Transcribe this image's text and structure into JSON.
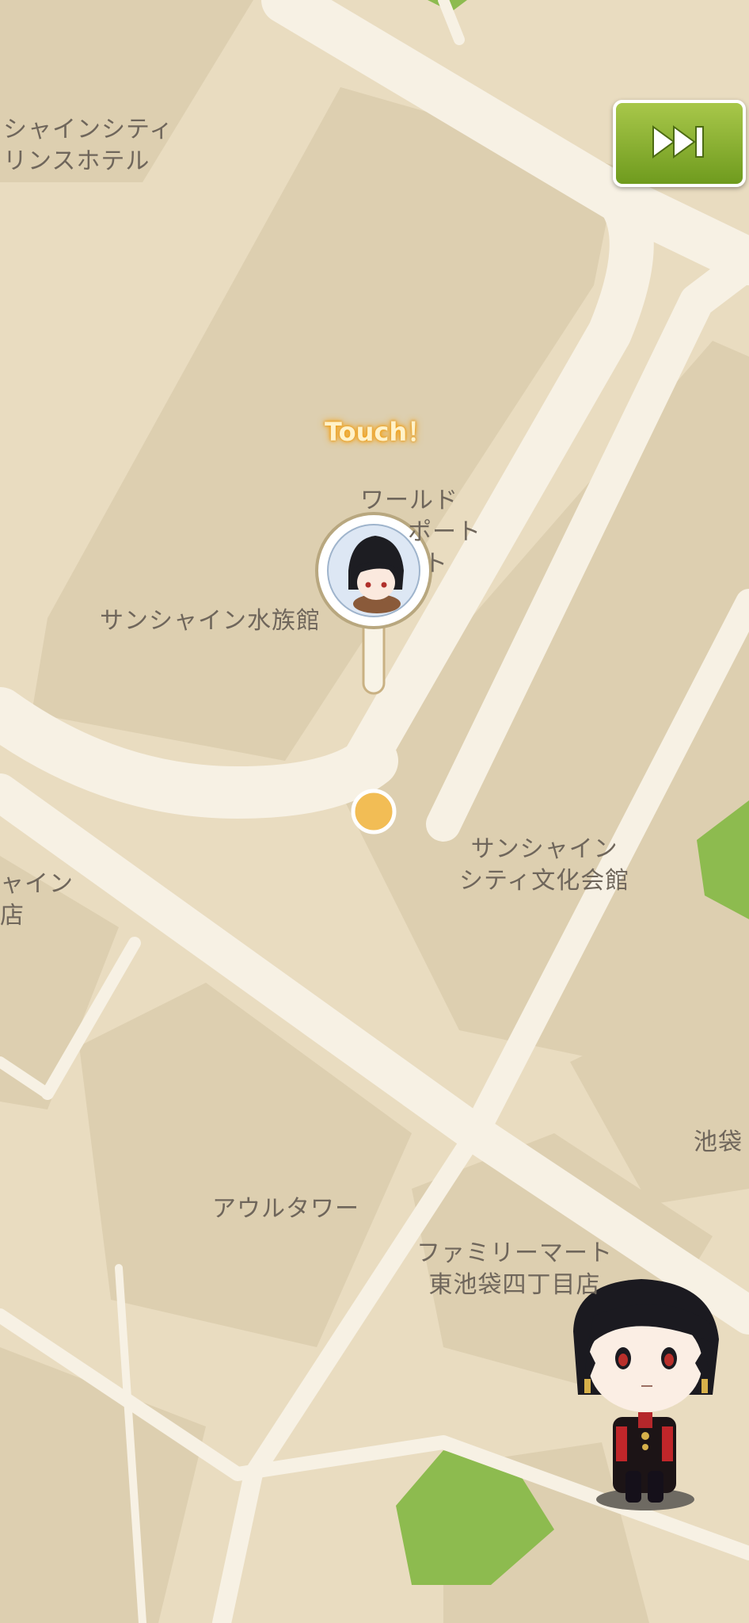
{
  "map": {
    "labels": {
      "prince_hotel_1": "シャインシティ",
      "prince_hotel_2": "リンスホテル",
      "world_1": "ワールド",
      "world_2": "ポート",
      "world_3": "ト",
      "aquarium": "サンシャイン水族館",
      "culture_1": "サンシャイン",
      "culture_2": "シティ文化会館",
      "left_1": "ャイン",
      "left_2": "店",
      "ikebukuro": "池袋",
      "owl_tower": "アウルタワー",
      "famima_1": "ファミリーマート",
      "famima_2": "東池袋四丁目店"
    }
  },
  "overlay": {
    "touch_prompt": "Touch！",
    "skip_icon": "fast-forward-icon"
  },
  "colors": {
    "map_bg": "#e9dcc0",
    "block": "#ddcfb0",
    "road": "#f7f1e4",
    "park": "#8dbb4f",
    "location_dot": "#f2bd55",
    "skip_button": "#86ad2c"
  }
}
